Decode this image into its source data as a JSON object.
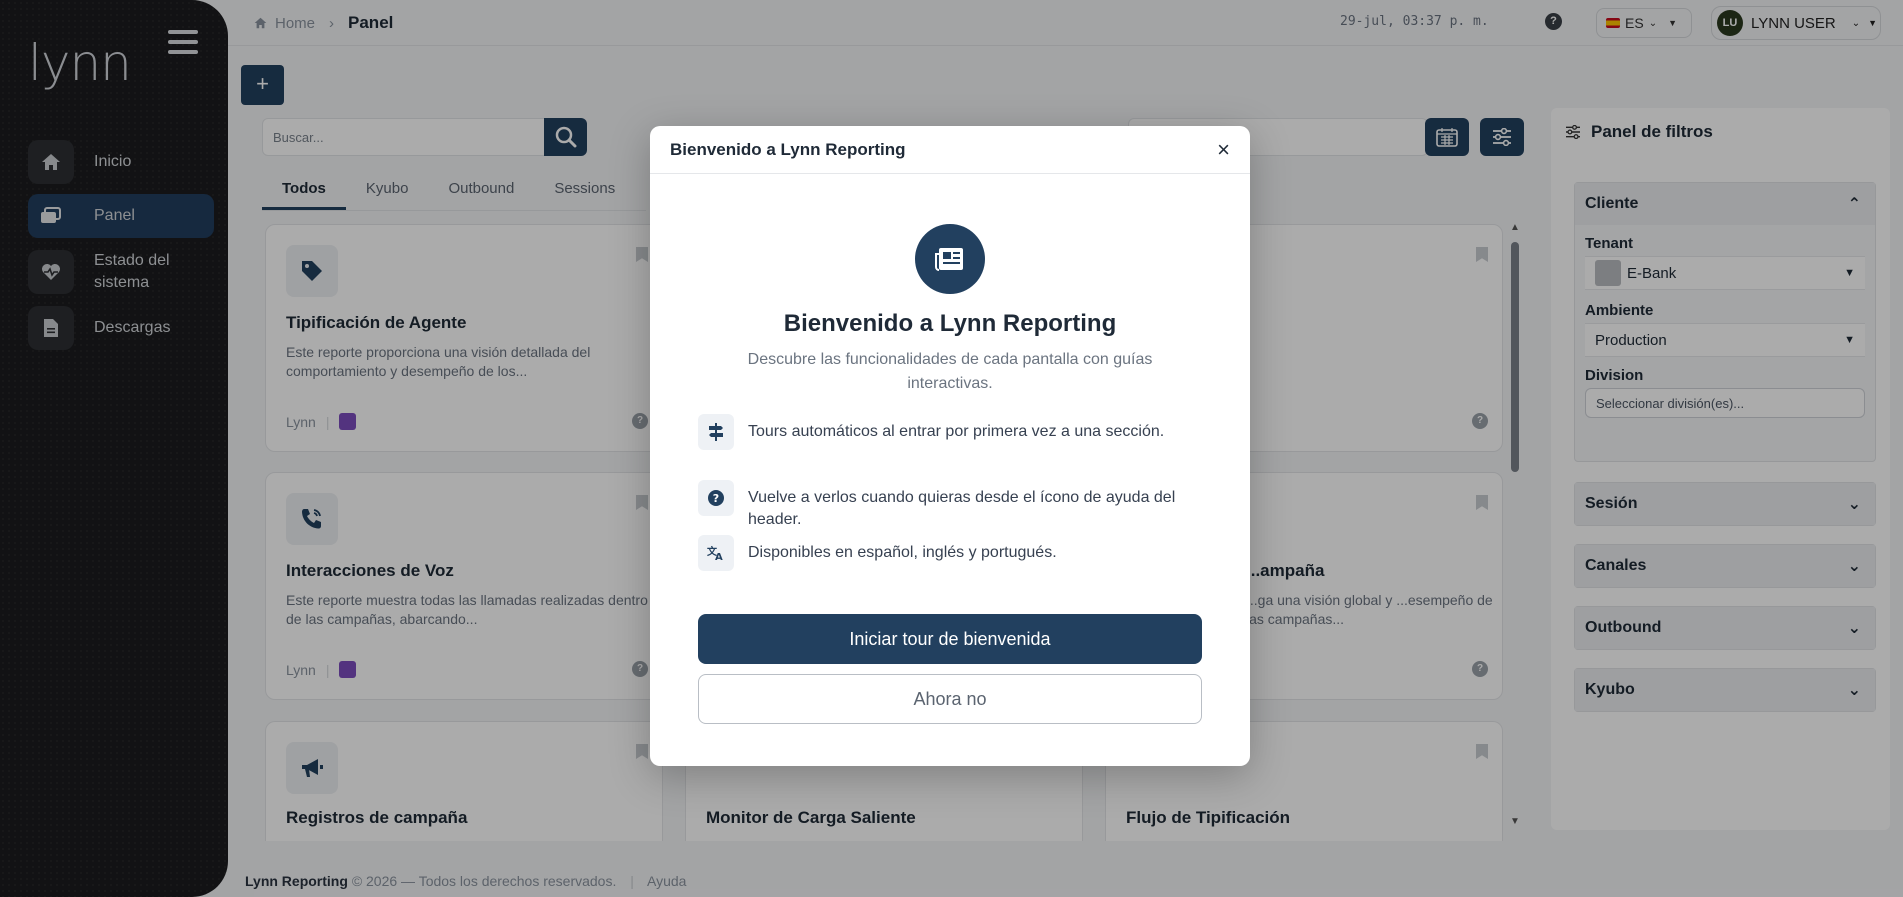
{
  "app": {
    "logo_text": "lynn"
  },
  "sidebar": {
    "items": [
      {
        "label": "Inicio",
        "icon": "home-icon"
      },
      {
        "label": "Panel",
        "icon": "dashboard-icon",
        "active": true
      },
      {
        "label": "Estado del sistema",
        "icon": "heart-monitor-icon"
      },
      {
        "label": "Descargas",
        "icon": "file-icon"
      }
    ]
  },
  "header": {
    "breadcrumb_home": "Home",
    "breadcrumb_current": "Panel",
    "clock": "29-jul, 03:37 p. m.",
    "help_label": "?",
    "language": "ES",
    "user_initials": "LU",
    "user_name": "LYNN USER"
  },
  "toolbar": {
    "add_label": "+",
    "search_placeholder": "Buscar..."
  },
  "tabs": [
    "Todos",
    "Kyubo",
    "Outbound",
    "Sessions"
  ],
  "cards": [
    {
      "title": "Tipificación de Agente",
      "desc": "Este reporte proporciona una visión detallada del comportamiento y desempeño de los...",
      "source": "Lynn"
    },
    {
      "title": "Interacciones de Voz",
      "desc": "Este reporte muestra todas las llamadas realizadas dentro de las campañas, abarcando...",
      "source": "Lynn"
    },
    {
      "title": "...ampaña",
      "desc": "...ga una visión global y ...esempeño de las campañas..."
    },
    {
      "title": "Registros de campaña"
    },
    {
      "title": "Monitor de Carga Saliente"
    },
    {
      "title": "Flujo de Tipificación"
    }
  ],
  "filters": {
    "title": "Panel de filtros",
    "cliente": {
      "title": "Cliente",
      "tenant_label": "Tenant",
      "tenant_value": "E-Bank",
      "ambiente_label": "Ambiente",
      "ambiente_value": "Production",
      "division_label": "Division",
      "division_placeholder": "Seleccionar división(es)..."
    },
    "sections": [
      "Sesión",
      "Canales",
      "Outbound",
      "Kyubo"
    ]
  },
  "footer": {
    "brand": "Lynn Reporting",
    "rights": "© 2026 — Todos los derechos reservados.",
    "help": "Ayuda"
  },
  "modal": {
    "header_title": "Bienvenido a Lynn Reporting",
    "close_label": "×",
    "heading": "Bienvenido a Lynn Reporting",
    "subheading": "Descubre las funcionalidades de cada pantalla con guías interactivas.",
    "features": [
      {
        "icon": "signpost-icon",
        "text": "Tours automáticos al entrar por primera vez a una sección."
      },
      {
        "icon": "question-circle-icon",
        "text": "Vuelve a verlos cuando quieras desde el ícono de ayuda del header."
      },
      {
        "icon": "translate-icon",
        "text": "Disponibles en español, inglés y portugués."
      }
    ],
    "primary_label": "Iniciar tour de bienvenida",
    "secondary_label": "Ahora no"
  },
  "colors": {
    "accent": "#22405f",
    "sidebar_bg": "#1b1c1e",
    "overlay": "rgba(0,0,0,0.33)"
  }
}
